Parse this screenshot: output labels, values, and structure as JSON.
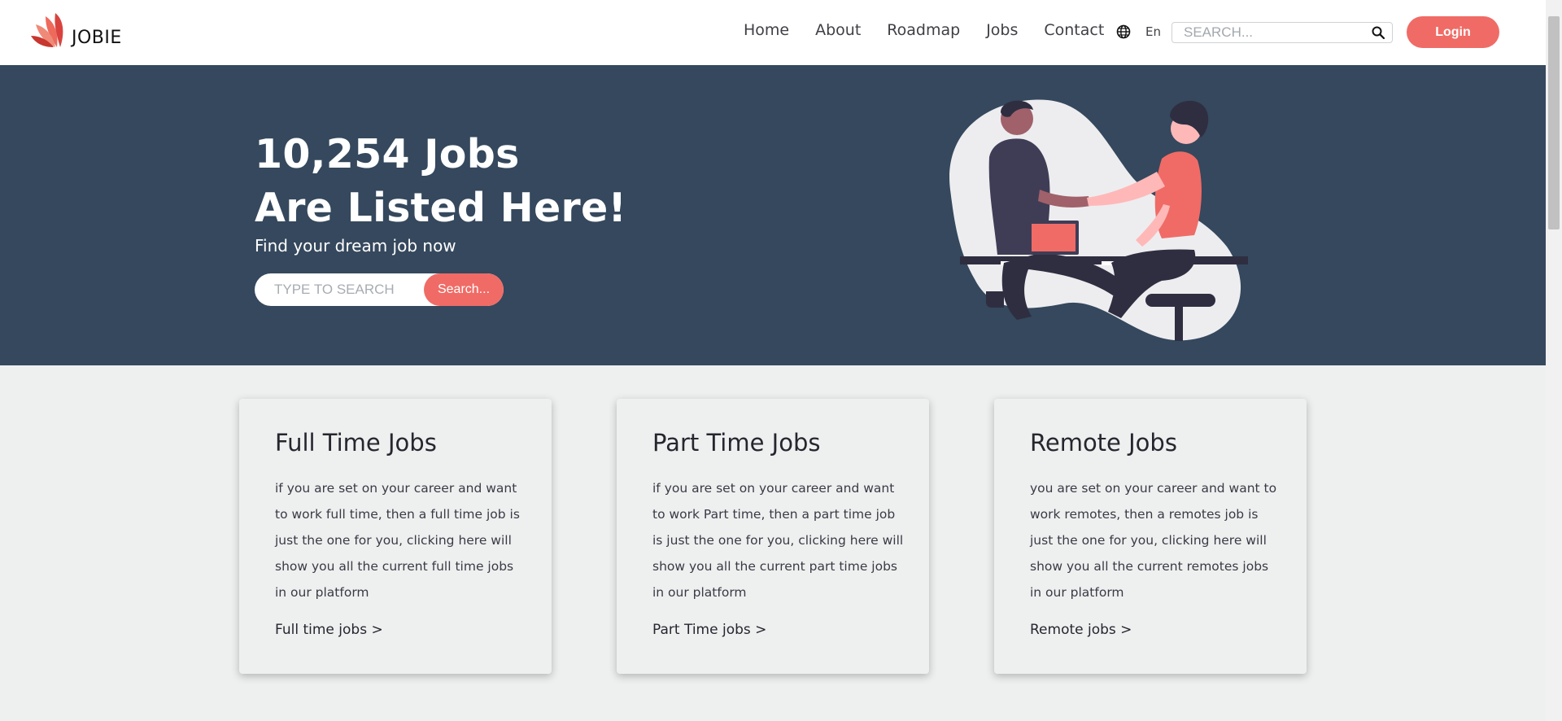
{
  "header": {
    "logo_text": "JOBIE",
    "nav": [
      "Home",
      "About",
      "Roadmap",
      "Jobs",
      "Contact"
    ],
    "language": "En",
    "search_placeholder": "SEARCH...",
    "login_label": "Login"
  },
  "hero": {
    "title_line1": "10,254 Jobs",
    "title_line2": "Are Listed Here!",
    "subtitle": "Find your dream job now",
    "search_placeholder": "TYPE TO SEARCH",
    "search_button": "Search..."
  },
  "cards": [
    {
      "title": "Full Time Jobs",
      "text": "if you are set on your career and want to work full time, then a full time job is just the one for you, clicking here will show you all the current full time jobs in our platform",
      "link": "Full time jobs >"
    },
    {
      "title": "Part Time Jobs",
      "text": "if you are set on your career and want to work Part time, then a part time job is just the one for you, clicking here will show you all the current part time jobs in our platform",
      "link": "Part Time jobs >"
    },
    {
      "title": "Remote Jobs",
      "text": "you are set on your career and want to work remotes, then a remotes job is just the one for you, clicking here will show you all the current remotes jobs in our platform",
      "link": "Remote jobs >"
    }
  ],
  "colors": {
    "accent": "#f06b66",
    "hero_bg": "#35485d",
    "page_bg": "#eef0f0"
  }
}
